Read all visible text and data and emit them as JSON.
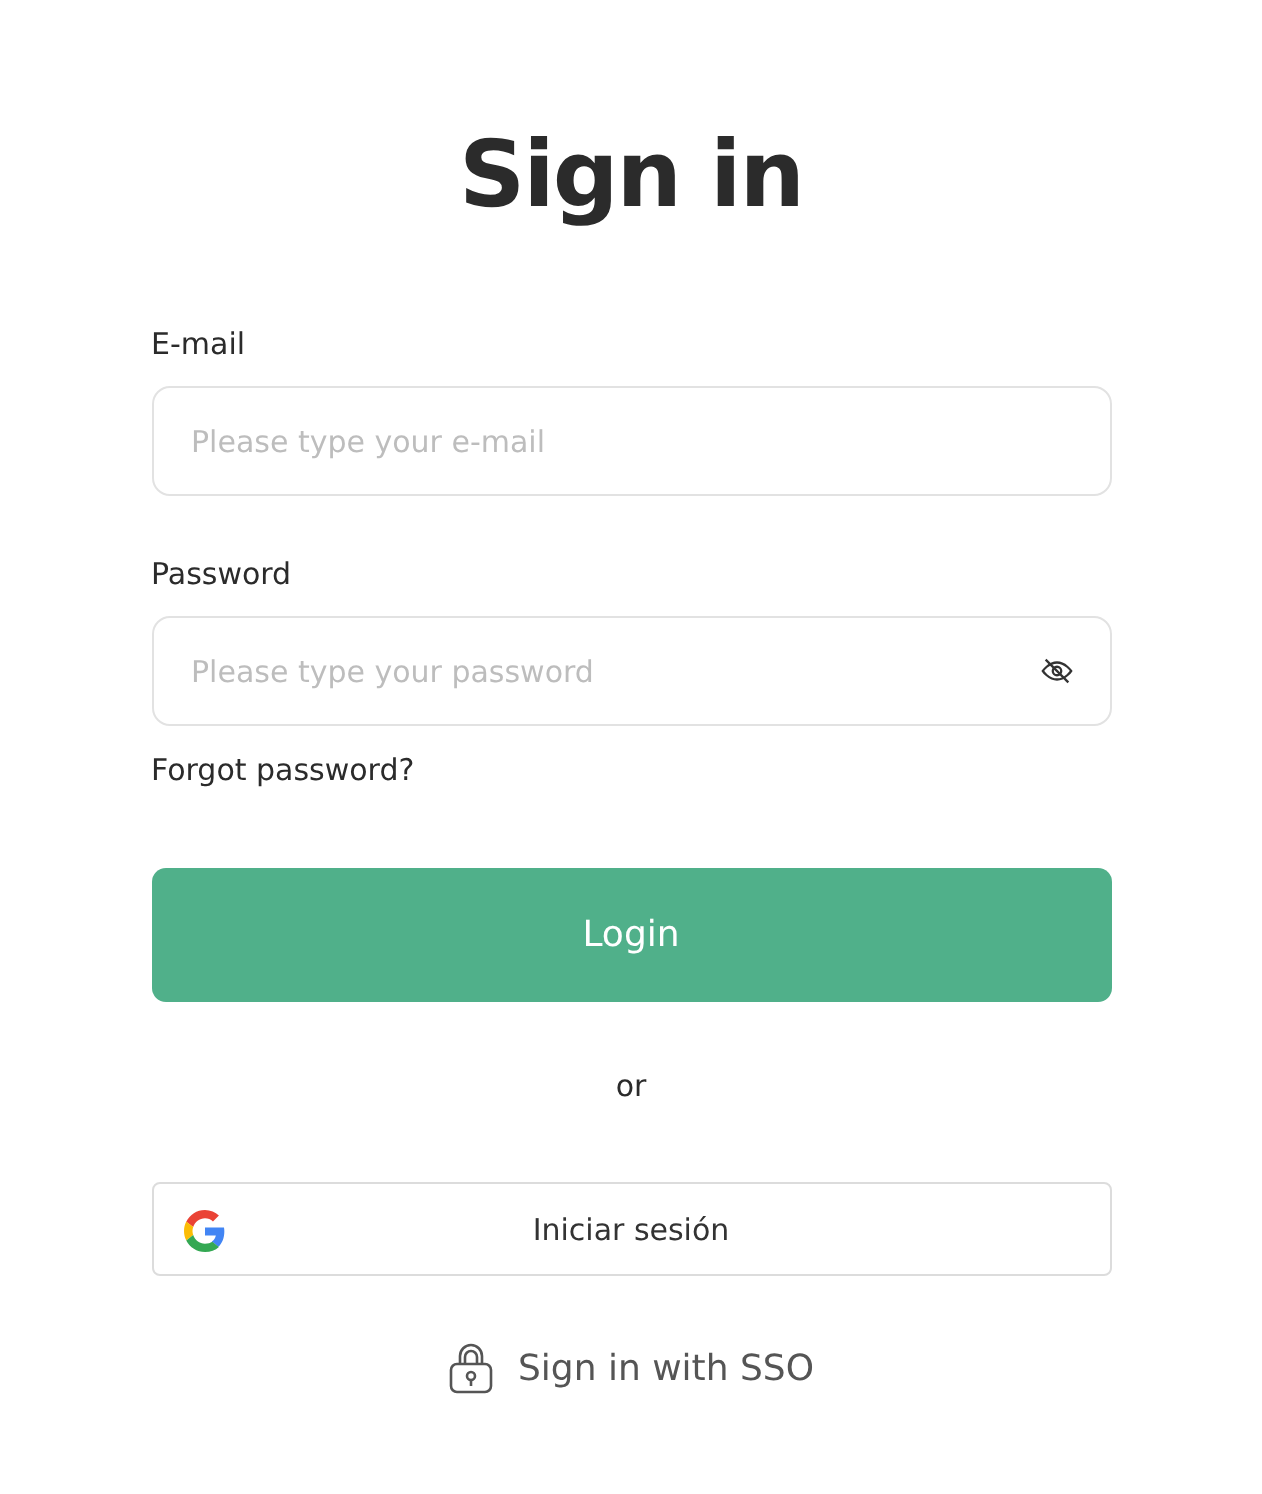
{
  "title": "Sign in",
  "fields": [
    {
      "kind": "email",
      "label": "E-mail",
      "placeholder": "Please type your e-mail"
    },
    {
      "kind": "password",
      "label": "Password",
      "placeholder": "Please type your password"
    }
  ],
  "forgot_link": "Forgot password?",
  "login_button": "Login",
  "divider": "or",
  "google_button": "Iniciar sesión",
  "sso_link": "Sign in with SSO"
}
